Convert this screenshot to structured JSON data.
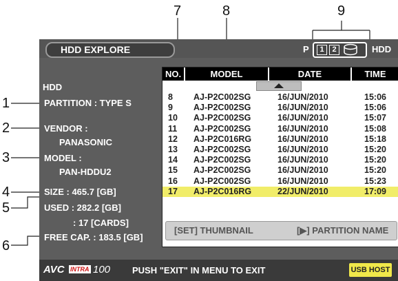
{
  "callouts": [
    "1",
    "2",
    "3",
    "4",
    "5",
    "6",
    "7",
    "8",
    "9"
  ],
  "title": "HDD EXPLORE",
  "top_right": {
    "prefix": "P",
    "slot1": "1",
    "slot2": "2",
    "hdd_label": "HDD"
  },
  "info": {
    "hdd": "HDD",
    "partition": "PARTITION : TYPE S",
    "vendor_label": "VENDOR :",
    "vendor_value": "PANASONIC",
    "model_label": "MODEL :",
    "model_value": "PAN-HDDU2",
    "size": "SIZE : 465.7 [GB]",
    "used": "USED : 282.2 [GB]",
    "cards": ": 17 [CARDS]",
    "free": "FREE CAP. : 183.5 [GB]"
  },
  "table": {
    "headers": [
      "NO.",
      "MODEL",
      "DATE",
      "TIME"
    ],
    "rows": [
      {
        "no": "8",
        "model": "AJ-P2C002SG",
        "date": "16/JUN/2010",
        "time": "15:06"
      },
      {
        "no": "9",
        "model": "AJ-P2C002SG",
        "date": "16/JUN/2010",
        "time": "15:06"
      },
      {
        "no": "10",
        "model": "AJ-P2C002SG",
        "date": "16/JUN/2010",
        "time": "15:07"
      },
      {
        "no": "11",
        "model": "AJ-P2C002SG",
        "date": "16/JUN/2010",
        "time": "15:08"
      },
      {
        "no": "12",
        "model": "AJ-P2C016RG",
        "date": "16/JUN/2010",
        "time": "15:18"
      },
      {
        "no": "13",
        "model": "AJ-P2C002SG",
        "date": "16/JUN/2010",
        "time": "15:20"
      },
      {
        "no": "14",
        "model": "AJ-P2C002SG",
        "date": "16/JUN/2010",
        "time": "15:20"
      },
      {
        "no": "15",
        "model": "AJ-P2C002SG",
        "date": "16/JUN/2010",
        "time": "15:20"
      },
      {
        "no": "16",
        "model": "AJ-P2C002SG",
        "date": "16/JUN/2010",
        "time": "15:23"
      },
      {
        "no": "17",
        "model": "AJ-P2C016RG",
        "date": "22/JUN/2010",
        "time": "17:09"
      }
    ],
    "thumb_button": "[SET] THUMBNAIL",
    "partition_button": "[▶] PARTITION NAME"
  },
  "footer": {
    "logo_avc": "AVC",
    "logo_intra": "INTRA",
    "logo_num": "100",
    "message": "PUSH \"EXIT\" IN MENU TO EXIT",
    "usb_host": "USB HOST"
  },
  "colors": {
    "selected_row": "#f1ed69",
    "usb_button": "#f0e84a",
    "screen_bg": "#5d5d5d"
  }
}
